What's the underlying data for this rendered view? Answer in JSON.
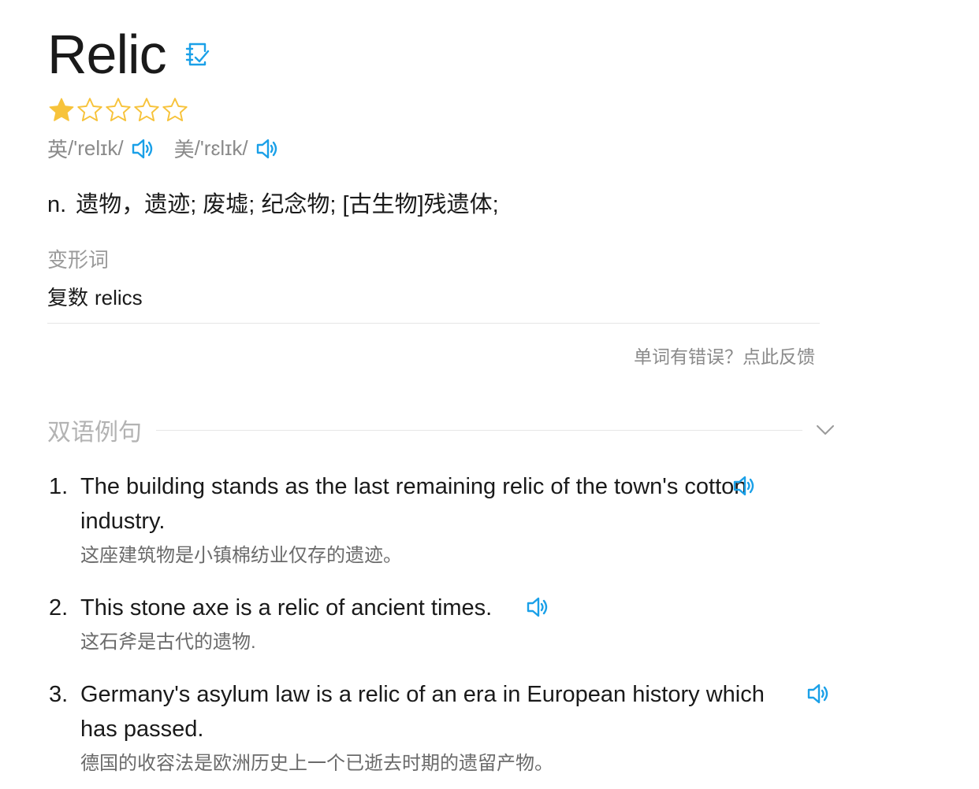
{
  "word": {
    "title": "Relic",
    "wordbook_icon": "add-to-wordbook-icon",
    "rating": 1,
    "rating_max": 5
  },
  "phonetics": {
    "uk_label": "英",
    "uk_ipa": "/'relɪk/",
    "us_label": "美",
    "us_ipa": "/'rɛlɪk/"
  },
  "definition": {
    "pos": "n.",
    "meaning": "遗物，遗迹; 废墟; 纪念物; [古生物]残遗体;"
  },
  "forms": {
    "label": "变形词",
    "type": "复数",
    "value": "relics"
  },
  "feedback": {
    "text": "单词有错误？点此反馈"
  },
  "examples_section": {
    "title": "双语例句",
    "items": [
      {
        "num": "1.",
        "en": "The building stands as the last remaining relic of the town's cotton industry.",
        "zh": "这座建筑物是小镇棉纺业仅存的遗迹。"
      },
      {
        "num": "2.",
        "en": "This stone axe is a relic of ancient times.",
        "zh": "这石斧是古代的遗物."
      },
      {
        "num": "3.",
        "en": "Germany's asylum law is a relic of an era in European history which has passed.",
        "zh": "德国的收容法是欧洲历史上一个已逝去时期的遗留产物。"
      }
    ]
  },
  "colors": {
    "accent": "#1aa0e8",
    "star_filled": "#f7c33b",
    "star_empty": "#f7c33b",
    "muted_text": "#8a8a8a",
    "divider": "#e6e6e6"
  },
  "icons": {
    "speaker": "speaker-icon",
    "star_filled": "star-filled-icon",
    "star_empty": "star-outline-icon",
    "chevron": "chevron-down-icon"
  }
}
